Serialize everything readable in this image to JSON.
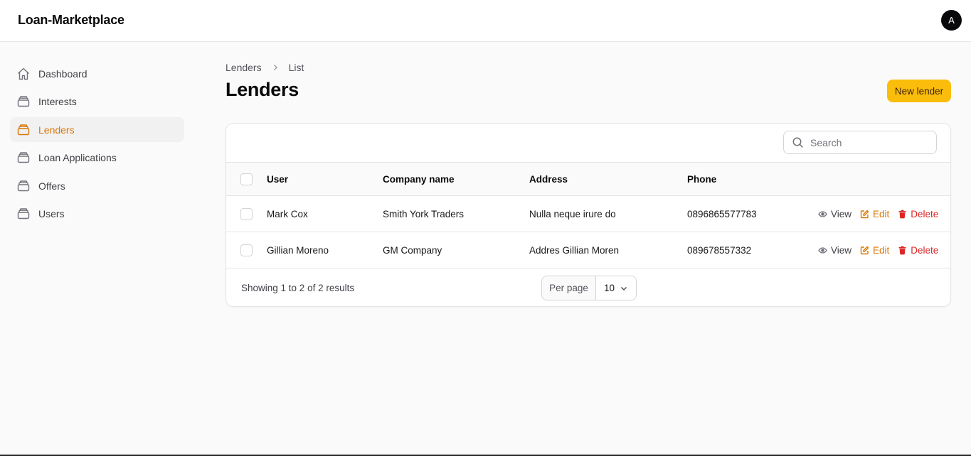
{
  "app": {
    "brand": "Loan-Marketplace",
    "avatar_initial": "A"
  },
  "colors": {
    "accent": "#d97706",
    "primary_button": "#fbbd0b",
    "danger": "#dc2626"
  },
  "sidebar": {
    "items": [
      {
        "label": "Dashboard",
        "icon": "home-icon",
        "active": false
      },
      {
        "label": "Interests",
        "icon": "stack-icon",
        "active": false
      },
      {
        "label": "Lenders",
        "icon": "stack-icon",
        "active": true
      },
      {
        "label": "Loan Applications",
        "icon": "stack-icon",
        "active": false
      },
      {
        "label": "Offers",
        "icon": "stack-icon",
        "active": false
      },
      {
        "label": "Users",
        "icon": "stack-icon",
        "active": false
      }
    ]
  },
  "breadcrumb": {
    "parent": "Lenders",
    "current": "List"
  },
  "page": {
    "title": "Lenders",
    "new_button": "New lender"
  },
  "table": {
    "search_placeholder": "Search",
    "columns": [
      "User",
      "Company name",
      "Address",
      "Phone"
    ],
    "rows": [
      {
        "user": "Mark Cox",
        "company": "Smith York Traders",
        "address": "Nulla neque irure do",
        "phone": "0896865577783"
      },
      {
        "user": "Gillian Moreno",
        "company": "GM Company",
        "address": "Addres Gillian Moren",
        "phone": "089678557332"
      }
    ],
    "actions": {
      "view": "View",
      "edit": "Edit",
      "delete": "Delete"
    },
    "summary": "Showing 1 to 2 of 2 results",
    "per_page_label": "Per page",
    "per_page_value": "10"
  }
}
